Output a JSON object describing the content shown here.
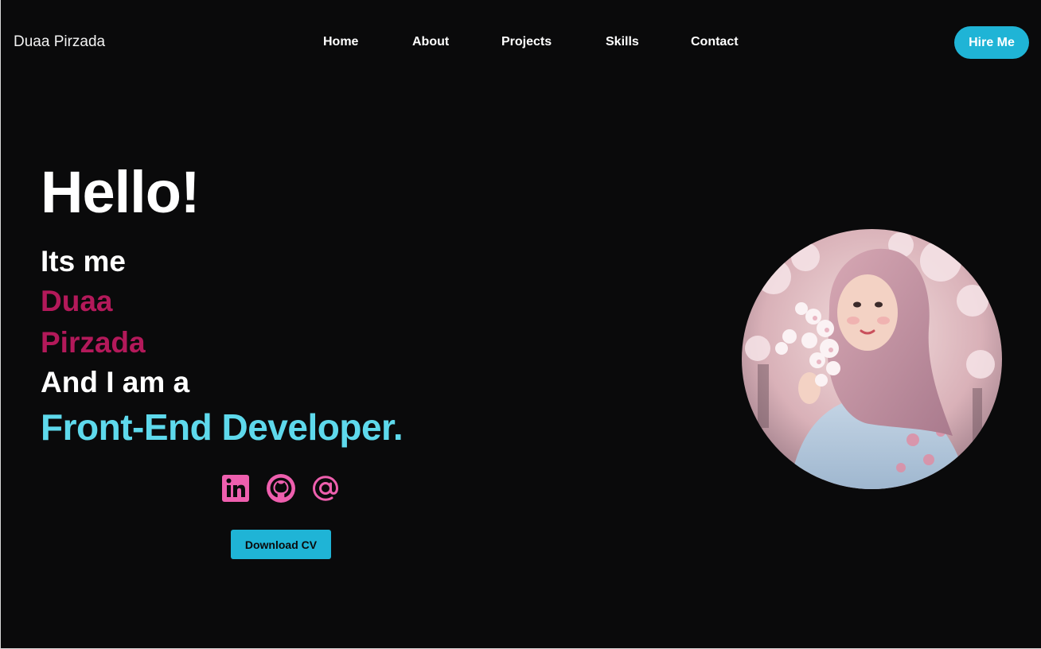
{
  "brand": "Duaa Pirzada",
  "nav": {
    "items": [
      "Home",
      "About",
      "Projects",
      "Skills",
      "Contact"
    ],
    "cta": "Hire Me"
  },
  "hero": {
    "greeting": "Hello!",
    "intro": "Its me",
    "first_name": "Duaa",
    "last_name": "Pirzada",
    "lead": "And I am a",
    "role": "Front-End Developer."
  },
  "social": {
    "icons": [
      "linkedin-icon",
      "github-icon",
      "at-sign-icon"
    ],
    "icon_color": "#ee5fae"
  },
  "download_cv": "Download CV",
  "colors": {
    "background": "#0a0a0b",
    "accent": "#1fb4d6",
    "name": "#b3195a",
    "role": "#5ed9ec"
  }
}
